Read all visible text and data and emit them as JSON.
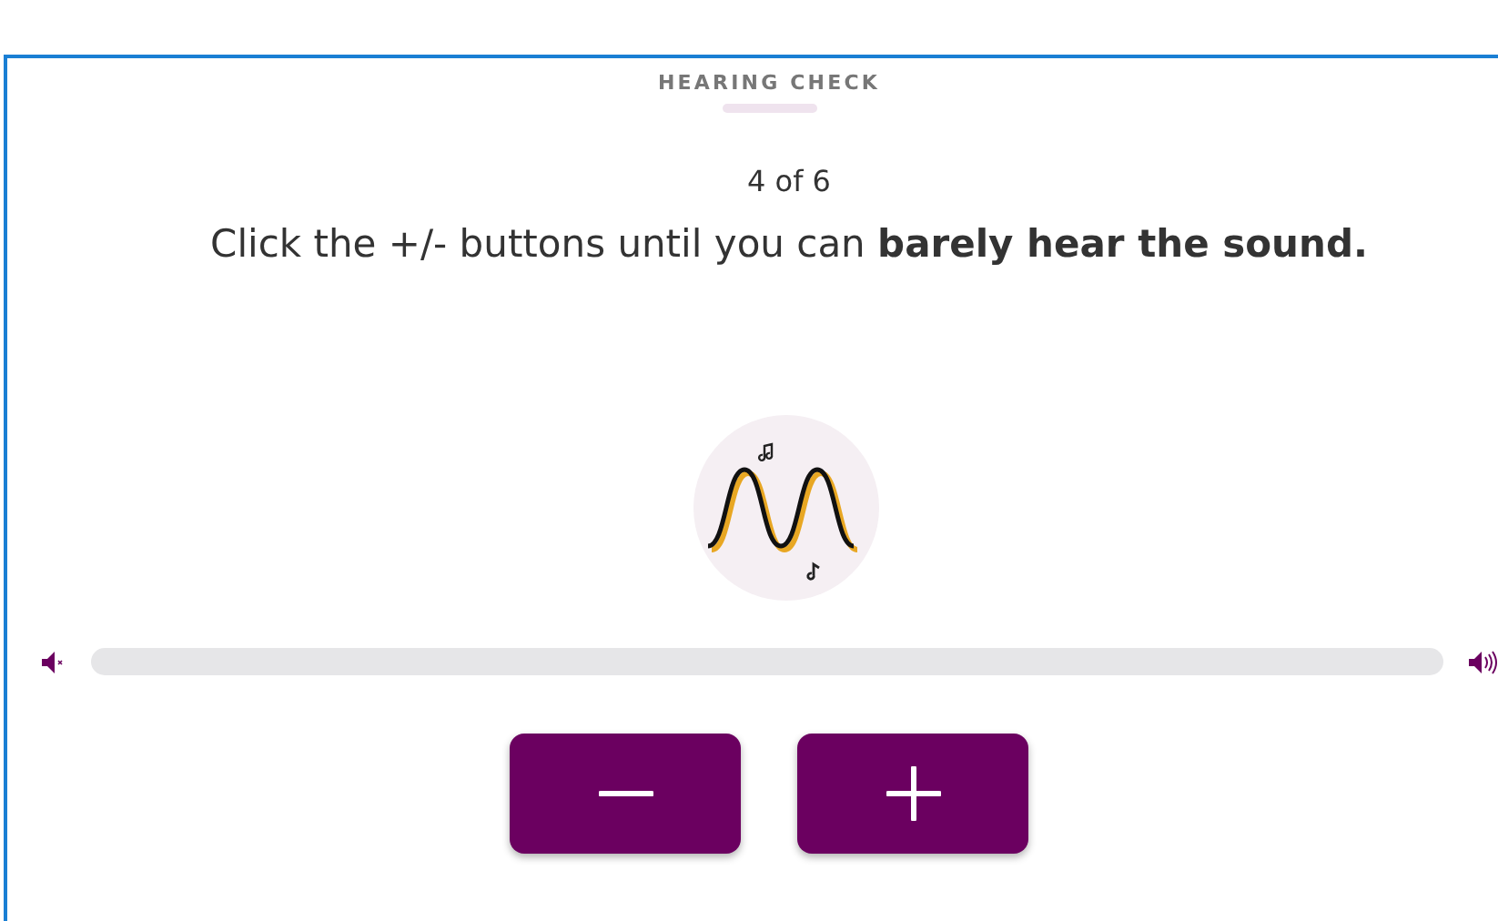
{
  "header": {
    "title": "HEARING CHECK",
    "progress": {
      "level": 1
    }
  },
  "step": "4 of 6",
  "instruction": "Click the +/- buttons until you can **barely hear the sound.**",
  "volume": {
    "level": 0
  },
  "buttons": [
    {
      "kind": "minus"
    },
    {
      "kind": "plus"
    }
  ]
}
